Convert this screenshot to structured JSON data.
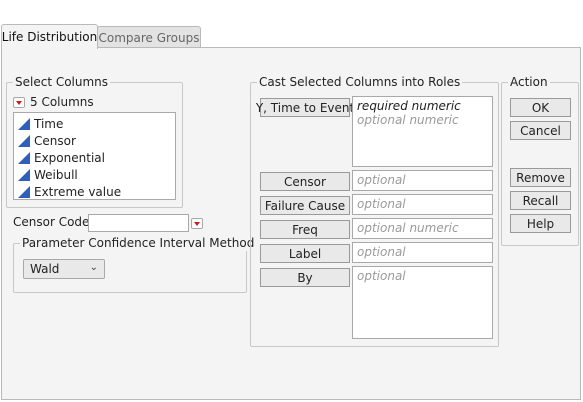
{
  "tabs": [
    {
      "label": "Life Distribution",
      "active": true
    },
    {
      "label": "Compare Groups",
      "active": false
    }
  ],
  "select_columns": {
    "title": "Select Columns",
    "count_label": "5 Columns",
    "columns": [
      "Time",
      "Censor",
      "Exponential",
      "Weibull",
      "Extreme value"
    ]
  },
  "censor_code": {
    "label": "Censor Code:",
    "value": ""
  },
  "param_ci": {
    "title": "Parameter Confidence Interval Method",
    "selected": "Wald"
  },
  "cast": {
    "title": "Cast Selected Columns into Roles",
    "roles": [
      {
        "label": "Y, Time to Event",
        "hint_required": "required numeric",
        "hint": "optional numeric"
      },
      {
        "label": "Censor",
        "hint": "optional"
      },
      {
        "label": "Failure Cause",
        "hint": "optional"
      },
      {
        "label": "Freq",
        "hint": "optional numeric"
      },
      {
        "label": "Label",
        "hint": "optional"
      },
      {
        "label": "By",
        "hint": "optional"
      }
    ]
  },
  "action": {
    "title": "Action",
    "buttons": [
      "OK",
      "Cancel",
      "Remove",
      "Recall",
      "Help"
    ]
  },
  "colors": {
    "icon_blue": "#2f5fb8",
    "red_arrow": "#d01b1b"
  }
}
